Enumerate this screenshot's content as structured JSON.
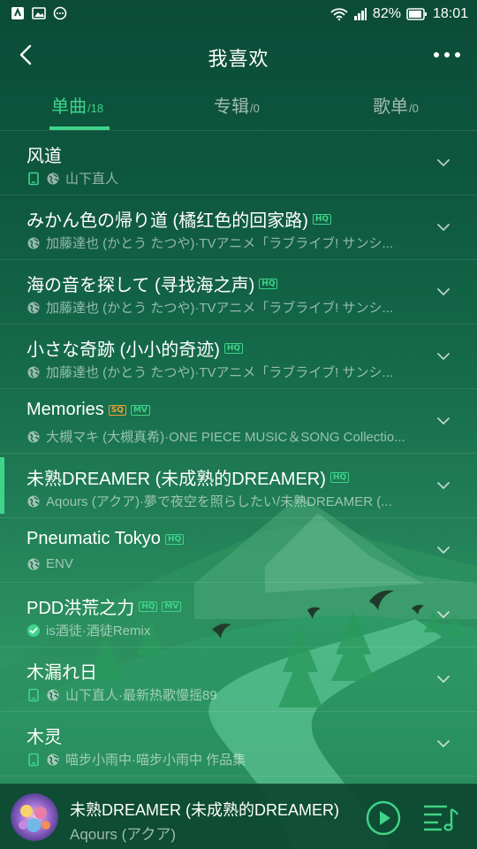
{
  "status_bar": {
    "battery": "82%",
    "time": "18:01"
  },
  "header": {
    "title": "我喜欢"
  },
  "tabs": [
    {
      "label": "单曲",
      "count": "/18",
      "active": true
    },
    {
      "label": "专辑",
      "count": "/0",
      "active": false
    },
    {
      "label": "歌单",
      "count": "/0",
      "active": false
    }
  ],
  "songs": [
    {
      "title": "风道",
      "subtitle": "山下直人",
      "local": true,
      "badges": []
    },
    {
      "title": "みかん色の帰り道 (橘红色的回家路)",
      "subtitle": "加藤達也 (かとう たつや)·TVアニメ「ラブライブ! サンシ...",
      "local": false,
      "badges": [
        "HQ"
      ]
    },
    {
      "title": "海の音を探して (寻找海之声)",
      "subtitle": "加藤達也 (かとう たつや)·TVアニメ「ラブライブ! サンシ...",
      "local": false,
      "badges": [
        "HQ"
      ]
    },
    {
      "title": "小さな奇跡 (小小的奇迹)",
      "subtitle": "加藤達也 (かとう たつや)·TVアニメ「ラブライブ! サンシ...",
      "local": false,
      "badges": [
        "HQ"
      ]
    },
    {
      "title": "Memories",
      "subtitle": "大槻マキ (大槻真希)·ONE PIECE MUSIC＆SONG Collectio...",
      "local": false,
      "badges": [
        "SQ",
        "MV"
      ]
    },
    {
      "title": "未熟DREAMER (未成熟的DREAMER)",
      "subtitle": "Aqours (アクア)·夢で夜空を照らしたい/未熟DREAMER (...",
      "local": false,
      "badges": [
        "HQ"
      ],
      "playing": true
    },
    {
      "title": "Pneumatic Tokyo",
      "subtitle": "ENV",
      "local": false,
      "badges": [
        "HQ"
      ]
    },
    {
      "title": "PDD洪荒之力",
      "subtitle": "is酒徒·酒徒Remix",
      "local": false,
      "badges": [
        "HQ",
        "MV"
      ],
      "downloaded": true
    },
    {
      "title": "木漏れ日",
      "subtitle": "山下直人·最新热歌慢摇89",
      "local": true,
      "badges": []
    },
    {
      "title": "木灵",
      "subtitle": "喵步小雨中·喵步小雨中 作品集",
      "local": true,
      "badges": []
    }
  ],
  "player": {
    "title": "未熟DREAMER (未成熟的DREAMER)",
    "artist": "Aqours (アクア)"
  },
  "colors": {
    "accent": "#3fd48a",
    "sq": "#f0a030"
  }
}
